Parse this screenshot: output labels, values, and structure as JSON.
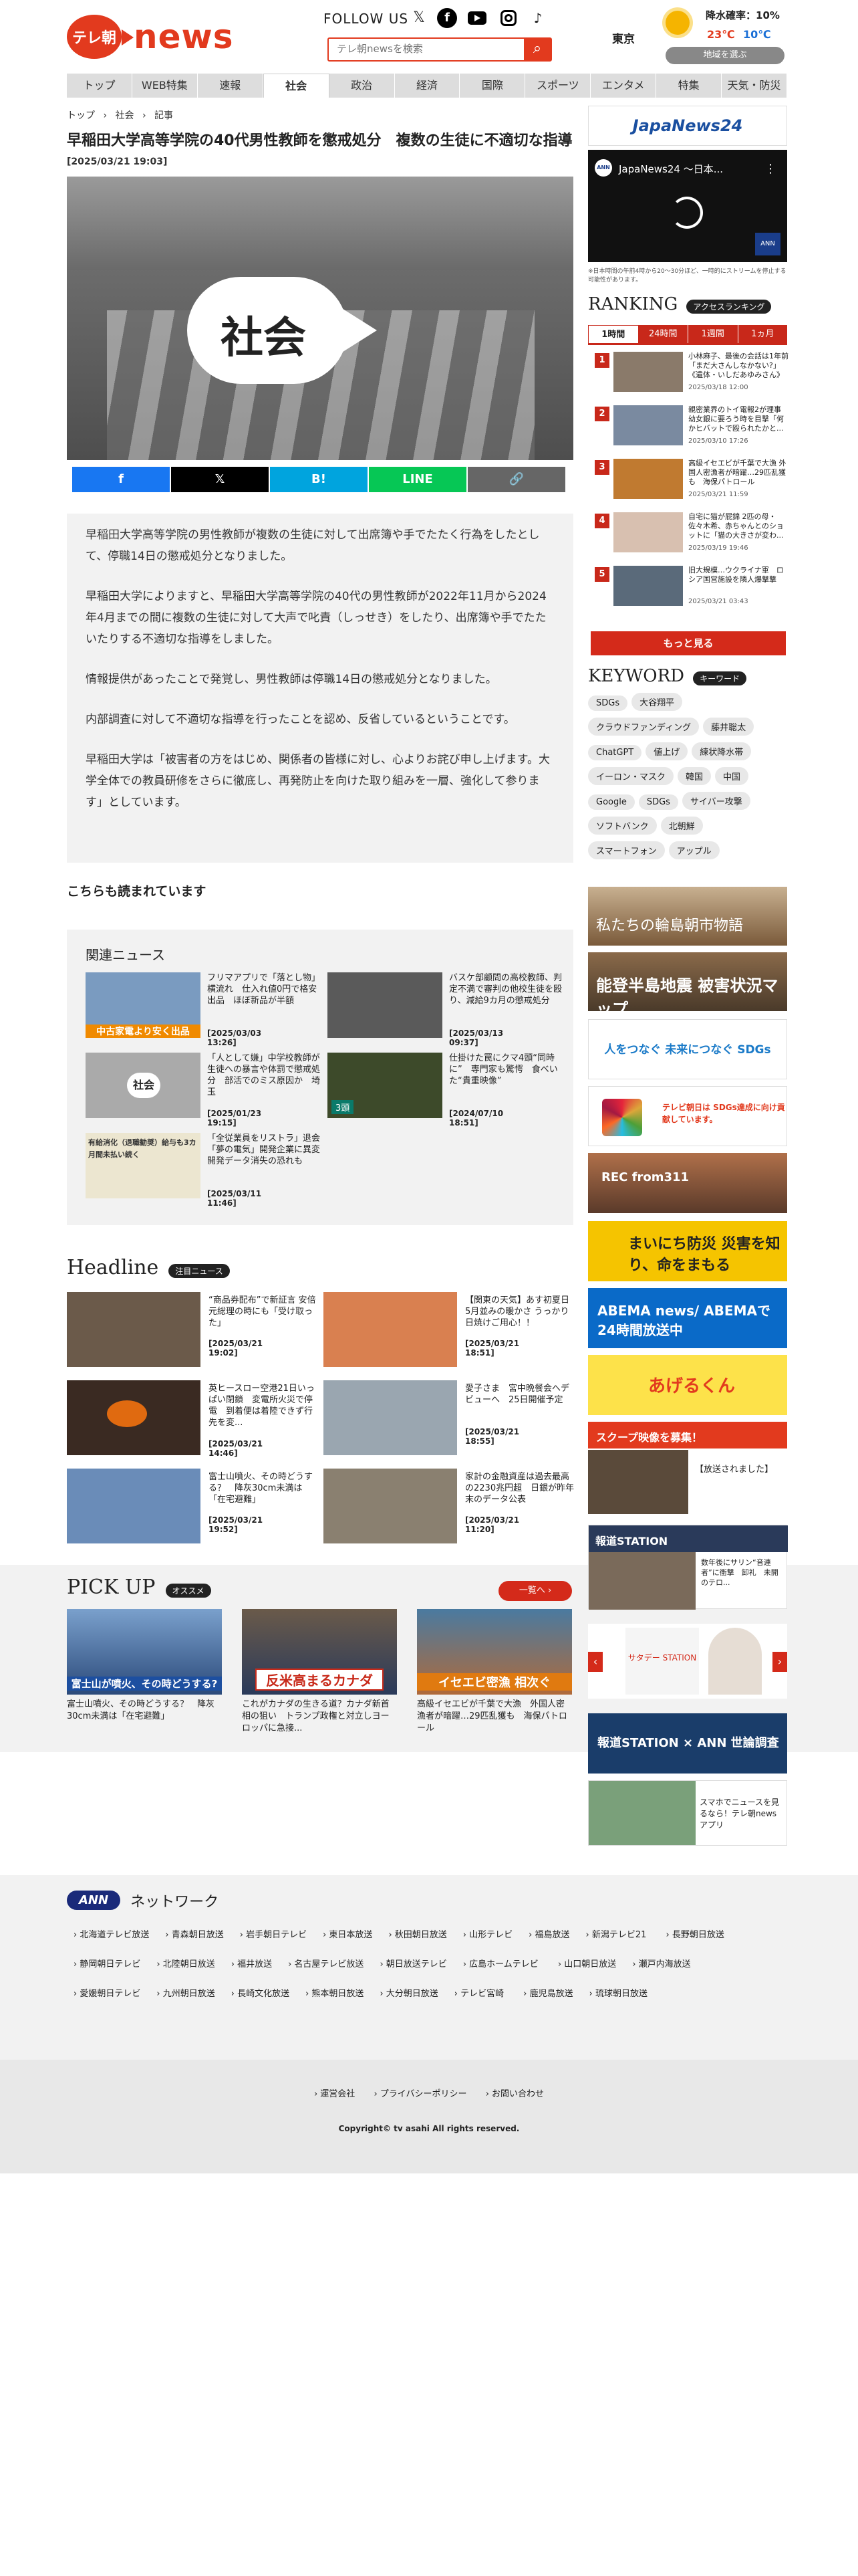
{
  "header": {
    "logo_mark": "テレ朝",
    "logo_text": "news",
    "follow": "FOLLOW US",
    "search_placeholder": "テレ朝newsを検索",
    "weather": {
      "city": "東京",
      "rain": "降水確率：10%",
      "high": "23℃",
      "low": "10℃",
      "region_btn": "地域を選ぶ"
    }
  },
  "nav": [
    "トップ",
    "WEB特集",
    "速報",
    "社会",
    "政治",
    "経済",
    "国際",
    "スポーツ",
    "エンタメ",
    "特集",
    "天気・防災"
  ],
  "breadcrumb": [
    "トップ",
    "社会",
    "記事"
  ],
  "article": {
    "title": "早稲田大学高等学院の40代男性教師を懲戒処分　複数の生徒に不適切な指導",
    "date": "[2025/03/21 19:03]",
    "hero_label": "社会",
    "share": [
      "f",
      "𝕏",
      "B!",
      "LINE",
      "🔗"
    ],
    "paragraphs": [
      "早稲田大学高等学院の男性教師が複数の生徒に対して出席簿や手でたたく行為をしたとして、停職14日の懲戒処分となりました。",
      "早稲田大学によりますと、早稲田大学高等学院の40代の男性教師が2022年11月から2024年4月までの間に複数の生徒に対して大声で叱責（しっせき）をしたり、出席簿や手でたたいたりする不適切な指導をしました。",
      "情報提供があったことで発覚し、男性教師は停職14日の懲戒処分となりました。",
      "内部調査に対して不適切な指導を行ったことを認め、反省しているということです。",
      "早稲田大学は「被害者の方をはじめ、関係者の皆様に対し、心よりお詫び申し上げます。大学全体での教員研修をさらに徹底し、再発防止を向けた取り組みを一層、強化して参ります」としています。"
    ]
  },
  "also_read": "こちらも読まれています",
  "related": {
    "title": "関連ニュース",
    "items": [
      {
        "text": "フリマアプリで「落とし物」横流れ　仕入れ値0円で格安出品　ほぼ新品が半額",
        "date": "[2025/03/03 13:26]",
        "img": "中古家電より安く出品"
      },
      {
        "text": "バスケ部顧問の高校教師、判定不満で審判の他校生徒を殴り、減給9カ月の懲戒処分",
        "date": "[2025/03/13 09:37]",
        "img": ""
      },
      {
        "text": "「人として嫌」中学校教師が生徒への暴言や体罰で懲戒処分　部活でのミス原因か　埼玉",
        "date": "[2025/01/23 19:15]",
        "img": "社会"
      },
      {
        "text": "仕掛けた罠にクマ4頭“同時に”　専門家も驚愕　食べいた“貴重映像”",
        "date": "[2024/07/10 18:51]",
        "img": "3頭"
      },
      {
        "text": "「全従業員をリストラ」退会「夢の電気」開発企業に異変　開発データ消失の恐れも",
        "date": "[2025/03/11 11:46]",
        "img": "有給消化（退職勧奨）給与も3カ月間未払い続く"
      }
    ]
  },
  "headline": {
    "title": "Headline",
    "tag": "注目ニュース",
    "items": [
      {
        "text": "“商品券配布”で新証言 安倍元総理の時にも「受け取った」",
        "date": "[2025/03/21 19:02]"
      },
      {
        "text": "【関東の天気】あす初夏日　5月並みの暖かさ うっかり日焼けご用心！！",
        "date": "[2025/03/21 18:51]"
      },
      {
        "text": "英ヒースロー空港21日いっぱい閉鎖　変電所火災で停電　到着便は着陸できず行先を変...",
        "date": "[2025/03/21 14:46]"
      },
      {
        "text": "愛子さま　宮中晩餐会へデビューへ　25日開催予定",
        "date": "[2025/03/21 18:55]"
      },
      {
        "text": "富士山噴火、その時どうする？　降灰30cm未満は「在宅避難」",
        "date": "[2025/03/21 19:52]"
      },
      {
        "text": "家計の金融資産は過去最高の2230兆円超　日銀が昨年末のデータ公表",
        "date": "[2025/03/21 11:20]"
      }
    ]
  },
  "pickup": {
    "title": "PICK UP",
    "tag": "オススメ",
    "more": "一覧へ",
    "items": [
      {
        "text": "富士山噴火、その時どうする？　降灰30cm未満は「在宅避難」",
        "img": "富士山が噴火、その時どうする?"
      },
      {
        "text": "これがカナダの生きる道？カナダ新首相の狙い　トランプ政権と対立しヨーロッパに急接...",
        "img": "反米高まるカナダ"
      },
      {
        "text": "高級イセエビが千葉で大漁　外国人密漁者が暗躍…29匹乱獲も　海保パトロール",
        "img": "イセエビ密漁 相次ぐ"
      }
    ]
  },
  "sidebar": {
    "video_brand": "JapaNews24",
    "video_title": "JapaNews24 ～日本...",
    "video_note": "※日本時間の午前4時から20〜30分ほど、一時的にストリームを停止する可能性があります。",
    "ranking_title": "RANKING",
    "ranking_tag": "アクセスランキング",
    "ranking_tabs": [
      "1時間",
      "24時間",
      "1週間",
      "1ヵ月"
    ],
    "ranking": [
      {
        "n": "1",
        "text": "小林麻子、最後の会話は1年前「まだ大さんしなかない?」《遺体・いしだあゆみさん》",
        "date": "2025/03/18 12:00"
      },
      {
        "n": "2",
        "text": "親密業界のトイ電報2が理事　幼女銀に要ろう時を目撃「何かヒバットで殴られたかと...",
        "date": "2025/03/10 17:26"
      },
      {
        "n": "3",
        "text": "高級イセエビが千葉で大漁 外国人密漁者が暗躍…29匹乱獲も　海保パトロール",
        "date": "2025/03/21 11:59"
      },
      {
        "n": "4",
        "text": "自宅に猫が屁錦 2匹の母・佐々木希、赤ちゃんとのショットに「猫の大きさが変わ...",
        "date": "2025/03/19 19:46"
      },
      {
        "n": "5",
        "text": "旧大規模…ウクライナ軍　ロシア国営施設を隣人爆撃撃",
        "date": "2025/03/21 03:43"
      }
    ],
    "ranking_more": "もっと見る",
    "keyword_title": "KEYWORD",
    "keyword_tag": "キーワード",
    "keywords": [
      "SDGs",
      "大谷翔平",
      "クラウドファンディング",
      "藤井聡太",
      "ChatGPT",
      "値上げ",
      "練状降水帯",
      "イーロン・マスク",
      "韓国",
      "中国",
      "Google",
      "SDGs",
      "サイバー攻撃",
      "ソフトバンク",
      "北朝鮮",
      "スマートフォン",
      "アップル"
    ],
    "banners": [
      "私たちの輪島朝市物語",
      "能登半島地震 被害状況マップ",
      "人をつなぐ 未来につなぐ SDGs",
      "テレビ朝日は SDGs達成に向け貢献しています。",
      "REC from311",
      "まいにち防災 災害を知り、命をまもる",
      "ABEMA news/ ABEMAで24時間放送中",
      "あげるくん",
      "スクープ映像を募集！",
      "【放送されました】",
      "報道STATION",
      "数年後にサリン“音連者”に衝撃　卸礼　未開のテロ...",
      "サタデー STATION",
      "報道STATION × ANN 世論調査",
      "スマホでニュースを見るなら！テレ朝newsアプリ"
    ]
  },
  "footer": {
    "ann": "ANN",
    "network_label": "ネットワーク",
    "stations": [
      "北海道テレビ放送",
      "青森朝日放送",
      "岩手朝日テレビ",
      "東日本放送",
      "秋田朝日放送",
      "山形テレビ",
      "福島放送",
      "新潟テレビ21",
      "長野朝日放送",
      "静岡朝日テレビ",
      "北陸朝日放送",
      "福井放送",
      "名古屋テレビ放送",
      "朝日放送テレビ",
      "広島ホームテレビ",
      "山口朝日放送",
      "瀬戸内海放送",
      "愛媛朝日テレビ",
      "九州朝日放送",
      "長崎文化放送",
      "熊本朝日放送",
      "大分朝日放送",
      "テレビ宮崎",
      "鹿児島放送",
      "琉球朝日放送"
    ],
    "links": [
      "運営会社",
      "プライバシーポリシー",
      "お問い合わせ"
    ],
    "copyright": "Copyright© tv asahi All rights reserved."
  },
  "colors": {
    "accent": "#e23a1e",
    "rank": "#c8281a",
    "nav_bg": "#dddddd"
  }
}
